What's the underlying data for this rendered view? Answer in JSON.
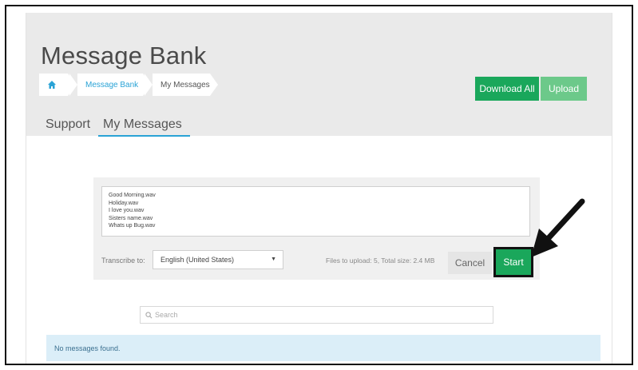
{
  "page": {
    "title": "Message Bank"
  },
  "breadcrumb": {
    "items": [
      "Message Bank",
      "My Messages"
    ]
  },
  "actions": {
    "download_all": "Download All",
    "upload": "Upload"
  },
  "tabs": [
    {
      "label": "Support",
      "active": false
    },
    {
      "label": "My Messages",
      "active": true
    }
  ],
  "upload_panel": {
    "files": [
      "Good Morning.wav",
      "Holiday.wav",
      "I love you.wav",
      "Sisters name.wav",
      "Whats up Bug.wav"
    ],
    "transcribe_label": "Transcribe to:",
    "language": "English (United States)",
    "files_info": "Files to upload: 5, Total size: 2.4 MB",
    "cancel": "Cancel",
    "start": "Start"
  },
  "search": {
    "placeholder": "Search"
  },
  "messages": {
    "empty": "No messages found."
  },
  "colors": {
    "primary_green": "#1aa75b",
    "light_green": "#6cc98a",
    "link_blue": "#2aa3d6",
    "info_bg": "#dbeef8"
  },
  "icons": {
    "home": "home-icon",
    "search": "search-icon",
    "caret": "chevron-down-icon",
    "annotation": "arrow-icon"
  }
}
